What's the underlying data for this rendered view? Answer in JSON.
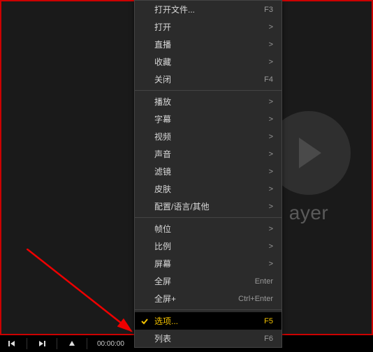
{
  "watermark": {
    "text": "ayer"
  },
  "controlbar": {
    "time": "00:00:00"
  },
  "menu": {
    "groups": [
      [
        {
          "label": "打开文件...",
          "shortcut": "F3",
          "submenu": false
        },
        {
          "label": "打开",
          "shortcut": ">",
          "submenu": true
        },
        {
          "label": "直播",
          "shortcut": ">",
          "submenu": true
        },
        {
          "label": "收藏",
          "shortcut": ">",
          "submenu": true
        },
        {
          "label": "关闭",
          "shortcut": "F4",
          "submenu": false
        }
      ],
      [
        {
          "label": "播放",
          "shortcut": ">",
          "submenu": true
        },
        {
          "label": "字幕",
          "shortcut": ">",
          "submenu": true
        },
        {
          "label": "视频",
          "shortcut": ">",
          "submenu": true
        },
        {
          "label": "声音",
          "shortcut": ">",
          "submenu": true
        },
        {
          "label": "滤镜",
          "shortcut": ">",
          "submenu": true
        },
        {
          "label": "皮肤",
          "shortcut": ">",
          "submenu": true
        },
        {
          "label": "配置/语言/其他",
          "shortcut": ">",
          "submenu": true
        }
      ],
      [
        {
          "label": "帧位",
          "shortcut": ">",
          "submenu": true
        },
        {
          "label": "比例",
          "shortcut": ">",
          "submenu": true
        },
        {
          "label": "屏幕",
          "shortcut": ">",
          "submenu": true
        },
        {
          "label": "全屏",
          "shortcut": "Enter",
          "submenu": false
        },
        {
          "label": "全屏+",
          "shortcut": "Ctrl+Enter",
          "submenu": false
        }
      ],
      [
        {
          "label": "选项...",
          "shortcut": "F5",
          "submenu": false,
          "selected": true,
          "checked": true
        },
        {
          "label": "列表",
          "shortcut": "F6",
          "submenu": false
        }
      ]
    ]
  }
}
